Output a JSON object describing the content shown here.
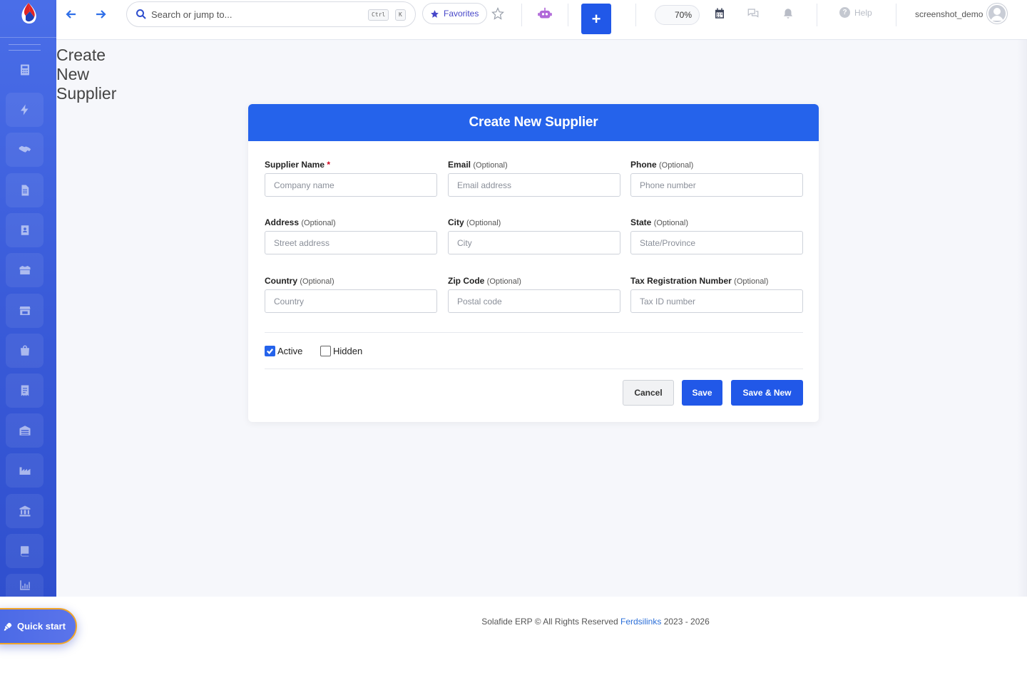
{
  "topbar": {
    "search_placeholder": "Search or jump to...",
    "kbd_ctrl": "Ctrl",
    "kbd_k": "K",
    "favorites_label": "Favorites",
    "plus_label": "+",
    "zoom": "70%",
    "help_label": "Help",
    "username": "screenshot_demo"
  },
  "page": {
    "title": "Create New Supplier"
  },
  "form": {
    "header": "Create New Supplier",
    "required_mark": "*",
    "fields": [
      {
        "label": "Supplier Name",
        "optional": "",
        "placeholder": "Company name",
        "required": true
      },
      {
        "label": "Email",
        "optional": "(Optional)",
        "placeholder": "Email address"
      },
      {
        "label": "Phone",
        "optional": "(Optional)",
        "placeholder": "Phone number"
      },
      {
        "label": "Address",
        "optional": "(Optional)",
        "placeholder": "Street address"
      },
      {
        "label": "City",
        "optional": "(Optional)",
        "placeholder": "City"
      },
      {
        "label": "State",
        "optional": "(Optional)",
        "placeholder": "State/Province"
      },
      {
        "label": "Country",
        "optional": "(Optional)",
        "placeholder": "Country"
      },
      {
        "label": "Zip Code",
        "optional": "(Optional)",
        "placeholder": "Postal code"
      },
      {
        "label": "Tax Registration Number",
        "optional": "(Optional)",
        "placeholder": "Tax ID number"
      }
    ],
    "checkboxes": [
      {
        "label": "Active",
        "checked": true
      },
      {
        "label": "Hidden",
        "checked": false
      }
    ],
    "buttons": {
      "cancel": "Cancel",
      "save": "Save",
      "save_new": "Save & New"
    }
  },
  "footer": {
    "prefix": "Solafide ERP © All Rights Reserved",
    "link": "Ferdsilinks",
    "years": "2023 - 2026"
  },
  "quick_start": {
    "label": "Quick start"
  },
  "colors": {
    "primary": "#2563eb",
    "sidebar": "#3a5bd9",
    "accent_orange": "#f0a52a"
  },
  "icons": {
    "sidebar": [
      "calculator-icon",
      "bolt-icon",
      "handshake-icon",
      "document-icon",
      "contact-card-icon",
      "boxes-icon",
      "store-icon",
      "shopping-bag-icon",
      "receipt-icon",
      "warehouse-icon",
      "factory-icon",
      "bank-icon",
      "book-icon",
      "chart-icon"
    ]
  }
}
